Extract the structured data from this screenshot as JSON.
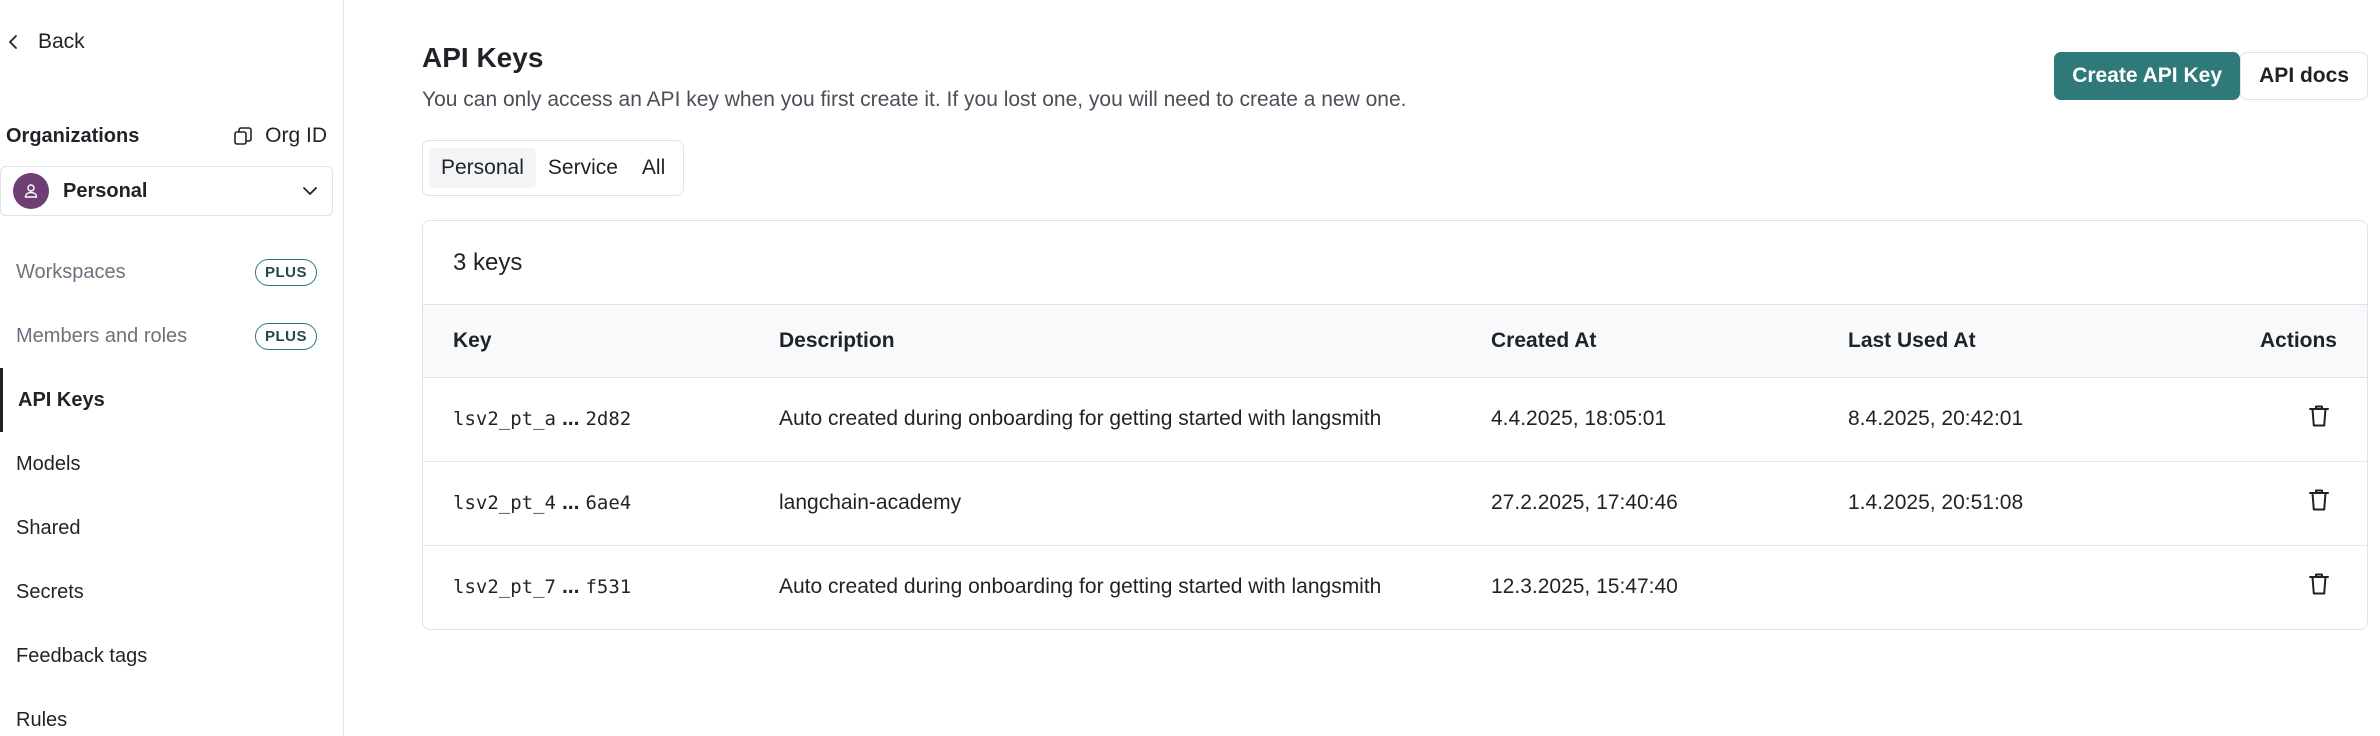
{
  "sidebar": {
    "back_label": "Back",
    "org_title": "Organizations",
    "org_id_label": "Org ID",
    "org_selected": "Personal",
    "items": [
      {
        "label": "Workspaces",
        "badge": "PLUS"
      },
      {
        "label": "Members and roles",
        "badge": "PLUS"
      },
      {
        "label": "API Keys"
      },
      {
        "label": "Models"
      },
      {
        "label": "Shared"
      },
      {
        "label": "Secrets"
      },
      {
        "label": "Feedback tags"
      },
      {
        "label": "Rules"
      }
    ]
  },
  "main": {
    "title": "API Keys",
    "subtitle": "You can only access an API key when you first create it. If you lost one, you will need to create a new one.",
    "create_button": "Create API Key",
    "docs_button": "API docs",
    "tabs": [
      "Personal",
      "Service",
      "All"
    ],
    "count_label": "3 keys",
    "columns": [
      "Key",
      "Description",
      "Created At",
      "Last Used At",
      "Actions"
    ],
    "rows": [
      {
        "key_prefix": "lsv2_pt_a",
        "key_suffix": "2d82",
        "description": "Auto created during onboarding for getting started with langsmith",
        "created": "4.4.2025, 18:05:01",
        "last_used": "8.4.2025, 20:42:01"
      },
      {
        "key_prefix": "lsv2_pt_4",
        "key_suffix": "6ae4",
        "description": "langchain-academy",
        "created": "27.2.2025, 17:40:46",
        "last_used": "1.4.2025, 20:51:08"
      },
      {
        "key_prefix": "lsv2_pt_7",
        "key_suffix": "f531",
        "description": "Auto created during onboarding for getting started with langsmith",
        "created": "12.3.2025, 15:47:40",
        "last_used": ""
      }
    ],
    "ellipsis": "..."
  },
  "colors": {
    "accent": "#2f7a78",
    "avatar": "#6e3f73",
    "badge_border": "#2d7a7a"
  }
}
